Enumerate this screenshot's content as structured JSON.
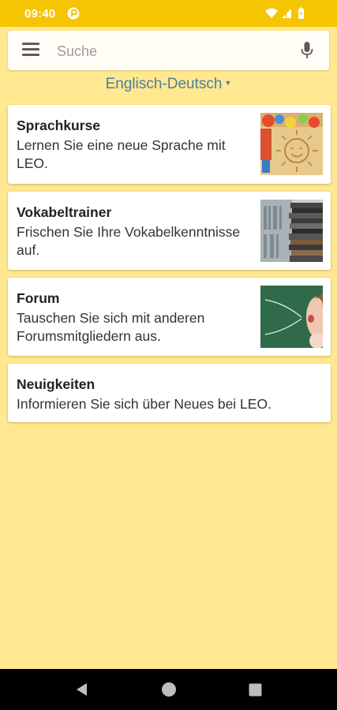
{
  "status_bar": {
    "time": "09:40",
    "app_icon": "leo-app-icon",
    "icons": [
      "wifi-icon",
      "signal-icon",
      "battery-icon"
    ]
  },
  "search": {
    "placeholder": "Suche",
    "menu_icon": "hamburger-menu-icon",
    "mic_icon": "microphone-icon"
  },
  "language": {
    "selected": "Englisch-Deutsch",
    "caret": "▼"
  },
  "cards": [
    {
      "title": "Sprachkurse",
      "description": "Lernen Sie eine neue Sprache mit LEO.",
      "image": "sun-drawing-image"
    },
    {
      "title": "Vokabeltrainer",
      "description": "Frischen Sie Ihre Vokabelkenntnisse auf.",
      "image": "book-stack-image"
    },
    {
      "title": "Forum",
      "description": "Tauschen Sie sich mit anderen Forumsmitgliedern aus.",
      "image": "chalkboard-person-image"
    },
    {
      "title": "Neuigkeiten",
      "description": "Informieren Sie sich über Neues bei LEO."
    }
  ],
  "nav_bar": {
    "buttons": [
      "back-icon",
      "home-icon",
      "recents-icon"
    ]
  },
  "colors": {
    "status_bar": "#f4c500",
    "background": "#ffe88f",
    "language_link": "#4e7ca0"
  }
}
